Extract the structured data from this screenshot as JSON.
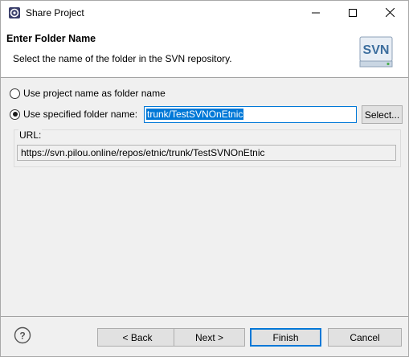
{
  "window": {
    "title": "Share Project",
    "app_icon": "eclipse-gear-icon"
  },
  "banner": {
    "title": "Enter Folder Name",
    "description": "Select the name of the folder in the SVN repository.",
    "logo_text": "SVN"
  },
  "options": {
    "use_project_name_label": "Use project name as folder name",
    "use_project_name_checked": false,
    "use_specified_label": "Use specified folder name:",
    "use_specified_checked": true,
    "folder_value": "trunk/TestSVNOnEtnic",
    "select_button": "Select..."
  },
  "url": {
    "label": "URL:",
    "value": "https://svn.pilou.online/repos/etnic/trunk/TestSVNOnEtnic"
  },
  "buttons": {
    "back": "< Back",
    "next": "Next >",
    "finish": "Finish",
    "cancel": "Cancel"
  },
  "colors": {
    "accent": "#0078d7",
    "window_bg": "#f0f0f0",
    "button_bg": "#e1e1e1"
  }
}
